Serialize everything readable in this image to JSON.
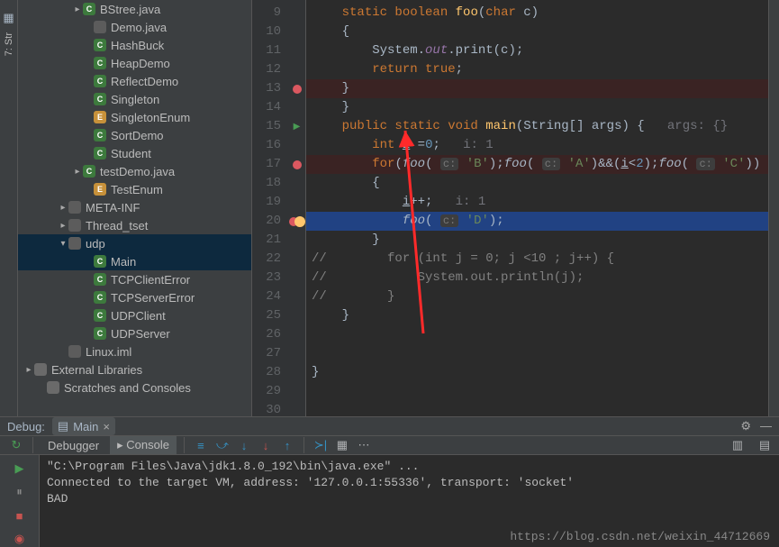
{
  "toolstrip": {
    "label": "7: Str"
  },
  "tree": [
    {
      "ind": 60,
      "chev": "▸",
      "icon": "C",
      "ic": "ic-c",
      "label": "BStree.java"
    },
    {
      "ind": 72,
      "chev": "",
      "icon": "",
      "ic": "ic-file",
      "label": "Demo.java"
    },
    {
      "ind": 72,
      "chev": "",
      "icon": "C",
      "ic": "ic-c",
      "label": "HashBuck"
    },
    {
      "ind": 72,
      "chev": "",
      "icon": "C",
      "ic": "ic-c",
      "label": "HeapDemo"
    },
    {
      "ind": 72,
      "chev": "",
      "icon": "C",
      "ic": "ic-c",
      "label": "ReflectDemo"
    },
    {
      "ind": 72,
      "chev": "",
      "icon": "C",
      "ic": "ic-c",
      "label": "Singleton"
    },
    {
      "ind": 72,
      "chev": "",
      "icon": "E",
      "ic": "ic-e",
      "label": "SingletonEnum"
    },
    {
      "ind": 72,
      "chev": "",
      "icon": "C",
      "ic": "ic-c",
      "label": "SortDemo"
    },
    {
      "ind": 72,
      "chev": "",
      "icon": "C",
      "ic": "ic-c",
      "label": "Student"
    },
    {
      "ind": 60,
      "chev": "▸",
      "icon": "C",
      "ic": "ic-c",
      "label": "testDemo.java"
    },
    {
      "ind": 72,
      "chev": "",
      "icon": "E",
      "ic": "ic-e",
      "label": "TestEnum"
    },
    {
      "ind": 44,
      "chev": "▸",
      "icon": "",
      "ic": "ic-folder",
      "label": "META-INF"
    },
    {
      "ind": 44,
      "chev": "▸",
      "icon": "",
      "ic": "ic-folder",
      "label": "Thread_tset"
    },
    {
      "ind": 44,
      "chev": "▾",
      "icon": "",
      "ic": "ic-folder",
      "label": "udp",
      "sel": true
    },
    {
      "ind": 72,
      "chev": "",
      "icon": "C",
      "ic": "ic-c",
      "label": "Main",
      "sel": true
    },
    {
      "ind": 72,
      "chev": "",
      "icon": "C",
      "ic": "ic-c",
      "label": "TCPClientError"
    },
    {
      "ind": 72,
      "chev": "",
      "icon": "C",
      "ic": "ic-c",
      "label": "TCPServerError"
    },
    {
      "ind": 72,
      "chev": "",
      "icon": "C",
      "ic": "ic-c",
      "label": "UDPClient"
    },
    {
      "ind": 72,
      "chev": "",
      "icon": "C",
      "ic": "ic-c",
      "label": "UDPServer"
    },
    {
      "ind": 44,
      "chev": "",
      "icon": "",
      "ic": "ic-file",
      "label": "Linux.iml"
    },
    {
      "ind": 6,
      "chev": "▸",
      "icon": "",
      "ic": "ic-lib",
      "label": "External Libraries"
    },
    {
      "ind": 20,
      "chev": "",
      "icon": "",
      "ic": "ic-lib",
      "label": "Scratches and Consoles"
    }
  ],
  "gutter": {
    "start": 9,
    "end": 30,
    "marks": {
      "13": "bp",
      "15": "run",
      "17": "bp",
      "20": "bp-bulb"
    }
  },
  "code": {
    "9": {
      "html": "    <span class='kw'>static boolean</span> <span class='fn'>foo</span>(<span class='kw'>char</span> c)"
    },
    "10": {
      "html": "    {"
    },
    "11": {
      "html": "        System.<span class='field'>out</span>.print(c);"
    },
    "12": {
      "html": "        <span class='kw'>return true</span>;"
    },
    "13": {
      "html": "    }",
      "cls": "bp-line"
    },
    "14": {
      "html": "    <span class='kw'>public static void</span> <span class='fn'>main</span>(String[] args) {   <span class='param'>args: {}</span>"
    },
    "15": {
      "html": "    <span class='kw'>public static void</span> <span class='fn'>main</span>(String[] args) {   <span class='param'>args: {}</span>",
      "skip": true
    },
    "16": {
      "html": "        <span class='kw'>int</span> <span class='ul'>i</span> =<span class='num'>0</span>;   <span class='param'>i: 1</span>"
    },
    "17": {
      "html": "        <span class='kw'>for</span>(<span class='it'>foo</span>( <span class='hint'>c:</span> <span class='str'>'B'</span>);<span class='it'>foo</span>( <span class='hint'>c:</span> <span class='str'>'A'</span>)&&(<span class='ul'>i</span>&lt;<span class='num'>2</span>);<span class='it'>foo</span>( <span class='hint'>c:</span> <span class='str'>'C'</span>))",
      "cls": "bp-line"
    },
    "18": {
      "html": "        {"
    },
    "19": {
      "html": "            <span class='ul'>i</span>++;   <span class='param'>i: 1</span>"
    },
    "20": {
      "html": "            <span class='it'>foo</span>( <span class='hint'>c:</span> <span class='str'>'D'</span>);",
      "cls": "cur-line"
    },
    "21": {
      "html": "        }"
    },
    "22": {
      "html": "<span class='cmt'>//        for (int j = 0; j &lt;10 ; j++) {</span>"
    },
    "23": {
      "html": "<span class='cmt'>//            System.out.println(j);</span>"
    },
    "24": {
      "html": "<span class='cmt'>//        }</span>"
    },
    "25": {
      "html": "    }"
    },
    "26": {
      "html": ""
    },
    "27": {
      "html": ""
    },
    "28": {
      "html": "}"
    },
    "29": {
      "html": ""
    },
    "30": {
      "html": ""
    }
  },
  "code_lines_real": {
    "9": "    static boolean foo(char c)",
    "10": "    {",
    "11": "        System.out.print(c);",
    "12": "        return true;",
    "13": "    }",
    "15": "    public static void main(String[] args) {   args: {}",
    "16": "        int i =0;   i: 1",
    "17": "        for(foo( c: 'B');foo( c: 'A')&&(i<2);foo( c: 'C'))",
    "18": "        {",
    "19": "            i++;   i: 1",
    "20": "            foo( c: 'D');",
    "21": "        }",
    "22": "//        for (int j = 0; j <10 ; j++) {",
    "23": "//            System.out.println(j);",
    "24": "//        }",
    "25": "    }",
    "28": "}"
  },
  "debug": {
    "title": "Debug:",
    "tab_icon": "▤",
    "run_config": "Main",
    "tabs": {
      "debugger": "Debugger",
      "console": "Console"
    },
    "console_lines": [
      "\"C:\\Program Files\\Java\\jdk1.8.0_192\\bin\\java.exe\" ...",
      "Connected to the target VM, address: '127.0.0.1:55336', transport: 'socket'",
      "BAD"
    ],
    "watermark": "https://blog.csdn.net/weixin_44712669"
  }
}
